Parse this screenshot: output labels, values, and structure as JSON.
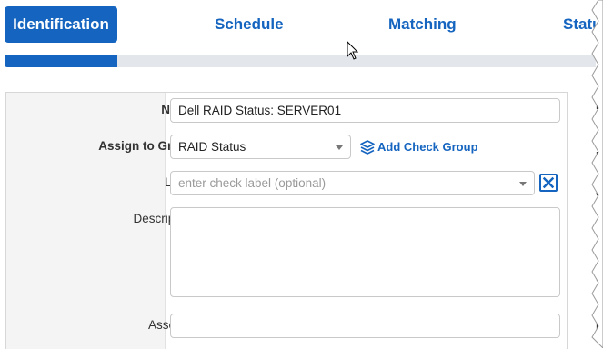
{
  "steps": [
    {
      "label": "Identification",
      "active": true
    },
    {
      "label": "Schedule",
      "active": false
    },
    {
      "label": "Matching",
      "active": false
    },
    {
      "label": "Status",
      "active": false
    }
  ],
  "progress": {
    "fraction": 0.19
  },
  "form": {
    "name": {
      "label": "Name",
      "value": "Dell RAID Status: SERVER01"
    },
    "group": {
      "label": "Assign to Group",
      "value": "RAID Status",
      "add_label": "Add Check Group"
    },
    "check_label": {
      "label": "Label",
      "placeholder": "enter check label (optional)"
    },
    "description": {
      "label": "Description",
      "value": ""
    },
    "asset_id": {
      "label": "Asset ID",
      "value": ""
    }
  },
  "side_fragments": [
    "I",
    "n",
    "N",
    "o",
    "n",
    "A",
    "d",
    "s",
    "L"
  ],
  "colors": {
    "accent": "#1565c0",
    "track": "#e3e7ec"
  }
}
